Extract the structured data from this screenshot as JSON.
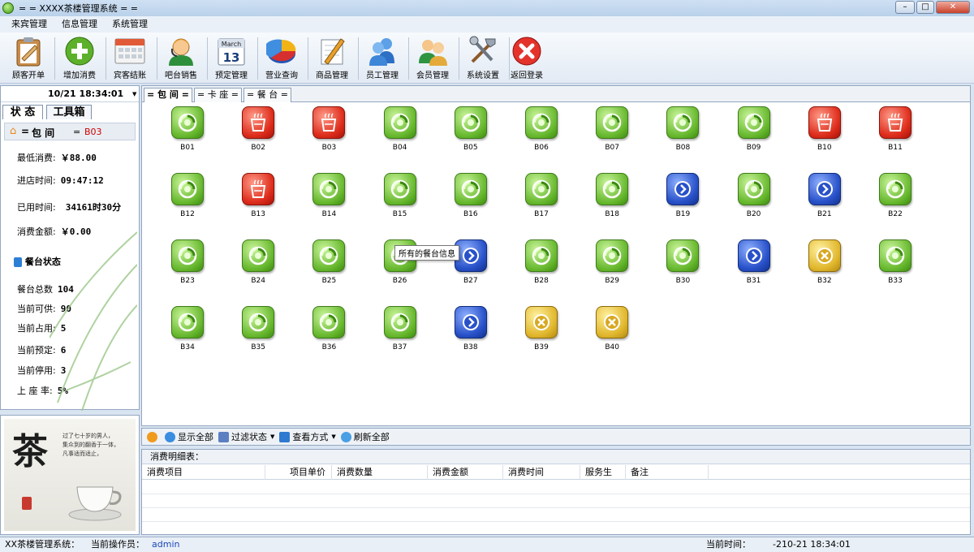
{
  "window": {
    "title": "= = XXXX茶楼管理系统 = ="
  },
  "menu": [
    "来宾管理",
    "信息管理",
    "系统管理"
  ],
  "toolbar": [
    {
      "label": "顾客开单",
      "icon": "clipboard-icon"
    },
    {
      "label": "增加消费",
      "icon": "add-icon"
    },
    {
      "label": "宾客结账",
      "icon": "calculator-icon"
    },
    {
      "label": "吧台销售",
      "icon": "operator-icon"
    },
    {
      "label": "预定管理",
      "icon": "calendar-icon"
    },
    {
      "label": "营业查询",
      "icon": "pie-chart-icon"
    },
    {
      "label": "商品管理",
      "icon": "edit-icon"
    },
    {
      "label": "员工管理",
      "icon": "users-icon"
    },
    {
      "label": "会员管理",
      "icon": "members-icon"
    },
    {
      "label": "系统设置",
      "icon": "tools-icon"
    },
    {
      "label": "返回登录",
      "icon": "close-icon"
    }
  ],
  "calendar_icon_text": {
    "month": "March",
    "day": "13"
  },
  "left": {
    "clock": "10/21 18:34:01",
    "tabs": [
      "状 态",
      "工具箱"
    ],
    "room_header": {
      "prefix": "包 间",
      "value": "B03"
    },
    "room_info": [
      {
        "label": "最低消费:",
        "value": "￥88.00"
      },
      {
        "label": "进店时间:",
        "value": "09:47:12"
      },
      {
        "label": "已用时间:",
        "value": "34161时30分"
      },
      {
        "label": "消费金额:",
        "value": "￥0.00"
      }
    ],
    "table_status_title": "餐台状态",
    "table_status": [
      {
        "label": "餐台总数",
        "value": "104"
      },
      {
        "label": "当前可供:",
        "value": "90"
      },
      {
        "label": "当前占用:",
        "value": "5"
      },
      {
        "label": "当前预定:",
        "value": "6"
      },
      {
        "label": "当前停用:",
        "value": "3"
      },
      {
        "label": "上 座 率:",
        "value": "5%"
      }
    ]
  },
  "promo": {
    "big_char": "茶",
    "poem": [
      "过了七十岁的男人，",
      "集众到的翻香于一体，",
      "凡事适而适止，"
    ]
  },
  "main_tabs": [
    "= 包 间 =",
    "= 卡 座 =",
    "= 餐 台 ="
  ],
  "rooms": [
    {
      "name": "B01",
      "status": "free"
    },
    {
      "name": "B02",
      "status": "occupied"
    },
    {
      "name": "B03",
      "status": "occupied"
    },
    {
      "name": "B04",
      "status": "free"
    },
    {
      "name": "B05",
      "status": "free"
    },
    {
      "name": "B06",
      "status": "free"
    },
    {
      "name": "B07",
      "status": "free"
    },
    {
      "name": "B08",
      "status": "free"
    },
    {
      "name": "B09",
      "status": "free"
    },
    {
      "name": "B10",
      "status": "occupied"
    },
    {
      "name": "B11",
      "status": "occupied"
    },
    {
      "name": "B12",
      "status": "free"
    },
    {
      "name": "B13",
      "status": "occupied"
    },
    {
      "name": "B14",
      "status": "free"
    },
    {
      "name": "B15",
      "status": "free"
    },
    {
      "name": "B16",
      "status": "free"
    },
    {
      "name": "B17",
      "status": "free"
    },
    {
      "name": "B18",
      "status": "free"
    },
    {
      "name": "B19",
      "status": "reserved"
    },
    {
      "name": "B20",
      "status": "free"
    },
    {
      "name": "B21",
      "status": "reserved"
    },
    {
      "name": "B22",
      "status": "free"
    },
    {
      "name": "B23",
      "status": "free"
    },
    {
      "name": "B24",
      "status": "free"
    },
    {
      "name": "B25",
      "status": "free"
    },
    {
      "name": "B26",
      "status": "free"
    },
    {
      "name": "B27",
      "status": "reserved"
    },
    {
      "name": "B28",
      "status": "free"
    },
    {
      "name": "B29",
      "status": "free"
    },
    {
      "name": "B30",
      "status": "free"
    },
    {
      "name": "B31",
      "status": "reserved"
    },
    {
      "name": "B32",
      "status": "disabled"
    },
    {
      "name": "B33",
      "status": "free"
    },
    {
      "name": "B34",
      "status": "free"
    },
    {
      "name": "B35",
      "status": "free"
    },
    {
      "name": "B36",
      "status": "free"
    },
    {
      "name": "B37",
      "status": "free"
    },
    {
      "name": "B38",
      "status": "reserved"
    },
    {
      "name": "B39",
      "status": "disabled"
    },
    {
      "name": "B40",
      "status": "disabled"
    }
  ],
  "tooltip": "所有的餐台信息",
  "bottom_toolbar": [
    "显示全部",
    "过滤状态",
    "查看方式",
    "刷新全部"
  ],
  "detail": {
    "title": "消费明细表：",
    "columns": [
      "消费项目",
      "项目单价",
      "消费数量",
      "消费金额",
      "消费时间",
      "服务生",
      "备注"
    ]
  },
  "statusbar": {
    "system_label": "XX茶楼管理系统：",
    "operator_label": "当前操作员：",
    "operator": "admin",
    "time_label": "当前时间：",
    "time": "-210-21 18:34:01"
  },
  "colors": {
    "free": "#63b52a",
    "occupied": "#de2d1c",
    "reserved": "#2851c9",
    "disabled": "#e1b72d",
    "highlight": "#cc0000"
  }
}
